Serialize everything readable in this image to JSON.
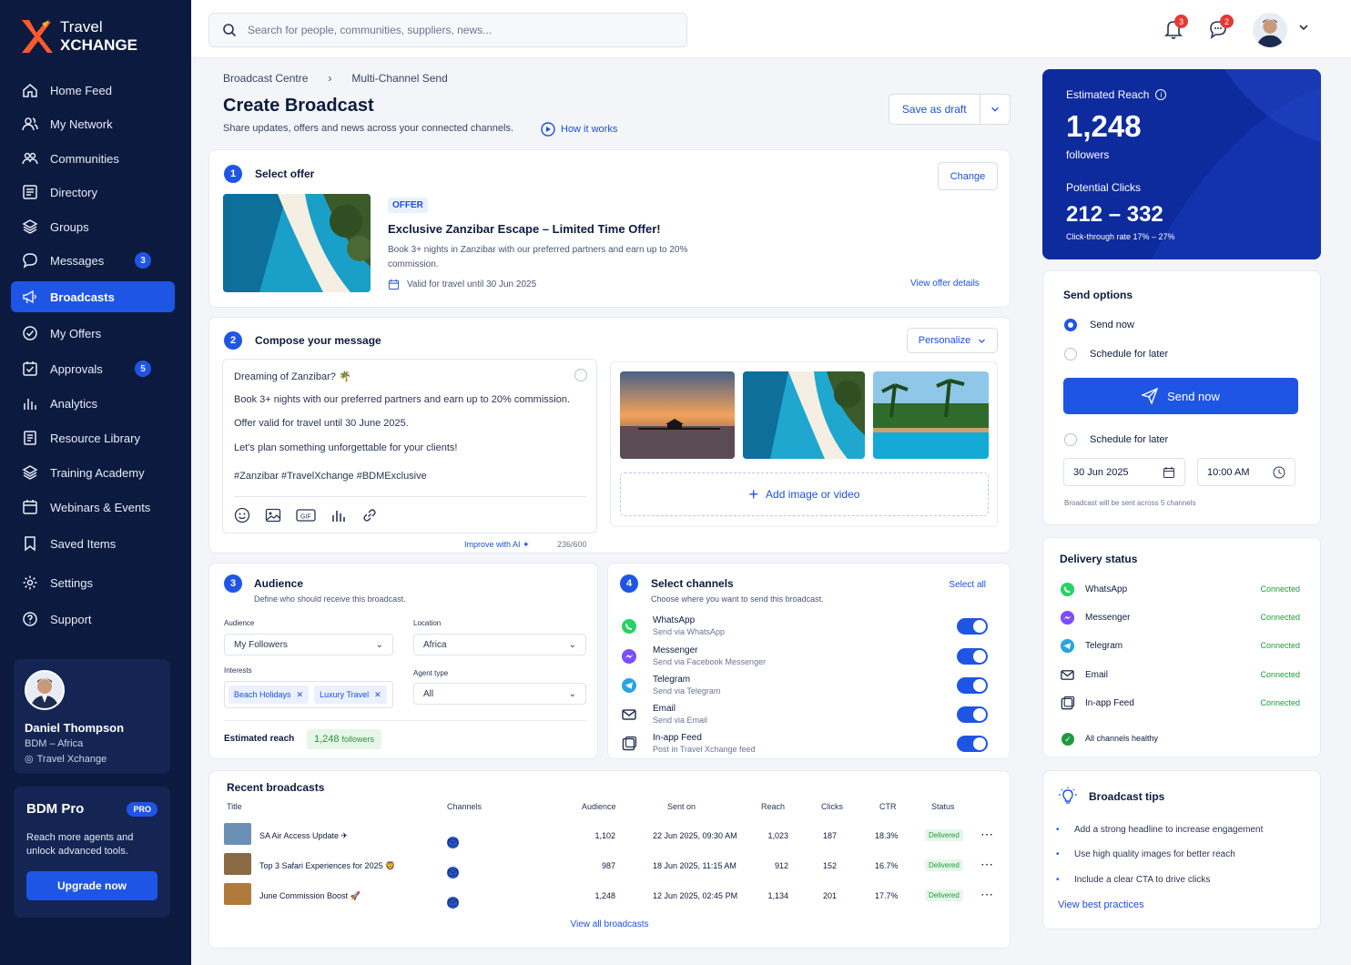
{
  "brand": {
    "line1": "Travel",
    "line2": "XCHANGE"
  },
  "nav": [
    {
      "label": "Home Feed",
      "icon": "home-icon"
    },
    {
      "label": "My Network",
      "icon": "users-icon"
    },
    {
      "label": "Communities",
      "icon": "community-icon"
    },
    {
      "label": "Directory",
      "icon": "directory-icon"
    },
    {
      "label": "Groups",
      "icon": "layers-icon"
    },
    {
      "label": "Messages",
      "icon": "chat-icon",
      "badge": "3"
    },
    {
      "label": "Broadcasts",
      "icon": "megaphone-icon",
      "active": true
    },
    {
      "label": "My Offers",
      "icon": "check-circle-icon"
    },
    {
      "label": "Approvals",
      "icon": "approval-icon",
      "badge": "5"
    },
    {
      "label": "Analytics",
      "icon": "bar-chart-icon"
    },
    {
      "label": "Resource Library",
      "icon": "library-icon"
    },
    {
      "label": "Training Academy",
      "icon": "academy-icon"
    },
    {
      "label": "Webinars & Events",
      "icon": "calendar-icon"
    },
    {
      "label": "Saved Items",
      "icon": "bookmark-icon"
    },
    {
      "label": "Settings",
      "icon": "gear-icon"
    },
    {
      "label": "Support",
      "icon": "support-icon"
    }
  ],
  "profile": {
    "name": "Daniel Thompson",
    "role": "BDM – Africa",
    "company": "Travel Xchange"
  },
  "pro": {
    "title": "BDM Pro",
    "badge": "PRO",
    "text1": "Reach more agents and",
    "text2": "unlock advanced tools.",
    "cta": "Upgrade now"
  },
  "search": {
    "placeholder": "Search for people, communities, suppliers, news..."
  },
  "topbar": {
    "notif_count": "3",
    "msg_count": "2"
  },
  "breadcrumb": {
    "root": "Broadcast Centre",
    "sep": "›",
    "current": "Multi-Channel Send"
  },
  "header": {
    "title": "Create Broadcast",
    "subtitle": "Share updates, offers and news across your connected channels.",
    "how": "How it works",
    "draft": "Save as draft"
  },
  "offer": {
    "step": "1",
    "title": "Select offer",
    "change": "Change",
    "tag": "OFFER",
    "name": "Exclusive Zanzibar Escape – Limited Time Offer!",
    "desc1": "Book 3+ nights in Zanzibar with our preferred partners and earn up to 20%",
    "desc2": "commission.",
    "valid": "Valid for travel until 30 Jun 2025",
    "details": "View offer details"
  },
  "compose": {
    "step": "2",
    "title": "Compose your message",
    "personalize": "Personalize",
    "l1": "Dreaming of Zanzibar? 🌴",
    "l2": "Book 3+ nights with our preferred partners and earn up to 20% commission.",
    "l3": "Offer valid for travel until 30 June 2025.",
    "l4": "Let's plan something unforgettable for your clients!",
    "l5": "#Zanzibar #TravelXchange #BDMExclusive",
    "ai": "Improve with AI",
    "count": "236/600",
    "add": "Add image or video"
  },
  "audience": {
    "step": "3",
    "title": "Audience",
    "sub": "Define who should receive this broadcast.",
    "aud_label": "Audience",
    "aud_val": "My Followers",
    "loc_label": "Location",
    "loc_val": "Africa",
    "int_label": "Interests",
    "chip1": "Beach Holidays",
    "chip2": "Luxury Travel",
    "agent_label": "Agent type",
    "agent_val": "All",
    "reach_label": "Estimated reach",
    "reach_val": "1,248",
    "reach_unit": "followers"
  },
  "channels": {
    "step": "4",
    "title": "Select channels",
    "sub": "Choose where you want to send this broadcast.",
    "select_all": "Select all",
    "items": [
      {
        "name": "WhatsApp",
        "desc": "Send via WhatsApp",
        "color": "#25d366"
      },
      {
        "name": "Messenger",
        "desc": "Send via Facebook Messenger",
        "color": "#7b4dff"
      },
      {
        "name": "Telegram",
        "desc": "Send via Telegram",
        "color": "#2aa3e0"
      },
      {
        "name": "Email",
        "desc": "Send via Email",
        "color": "#2a3553"
      },
      {
        "name": "In-app Feed",
        "desc": "Post in Travel Xchange feed",
        "color": "#2a3553"
      }
    ]
  },
  "recent": {
    "title": "Recent broadcasts",
    "headers": [
      "Title",
      "Channels",
      "Audience",
      "Sent on",
      "Reach",
      "Clicks",
      "CTR",
      "Status"
    ],
    "rows": [
      {
        "title": "SA Air Access Update ✈",
        "audience": "1,102",
        "sent": "22 Jun 2025, 09:30 AM",
        "reach": "1,023",
        "clicks": "187",
        "ctr": "18.3%",
        "status": "Delivered"
      },
      {
        "title": "Top 3 Safari Experiences for 2025 🦁",
        "audience": "987",
        "sent": "18 Jun 2025, 11:15 AM",
        "reach": "912",
        "clicks": "152",
        "ctr": "16.7%",
        "status": "Delivered"
      },
      {
        "title": "June Commission Boost 🚀",
        "audience": "1,248",
        "sent": "12 Jun 2025, 02:45 PM",
        "reach": "1,134",
        "clicks": "201",
        "ctr": "17.7%",
        "status": "Delivered"
      }
    ],
    "view_all": "View all broadcasts"
  },
  "reach": {
    "label": "Estimated Reach",
    "value": "1,248",
    "unit": "followers",
    "clicks_label": "Potential Clicks",
    "clicks": "212 – 332",
    "ctr": "Click-through rate 17% – 27%"
  },
  "send": {
    "title": "Send options",
    "opt1": "Send now",
    "opt2": "Schedule for later",
    "btn": "Send now",
    "opt3": "Schedule for later",
    "date": "30 Jun 2025",
    "time": "10:00 AM",
    "note": "Broadcast will be sent across 5 channels"
  },
  "delivery": {
    "title": "Delivery status",
    "items": [
      {
        "name": "WhatsApp",
        "status": "Connected",
        "color": "#25d366"
      },
      {
        "name": "Messenger",
        "status": "Connected",
        "color": "#7b4dff"
      },
      {
        "name": "Telegram",
        "status": "Connected",
        "color": "#2aa3e0"
      },
      {
        "name": "Email",
        "status": "Connected",
        "color": "#2a3553"
      },
      {
        "name": "In-app Feed",
        "status": "Connected",
        "color": "#2a3553"
      }
    ],
    "healthy": "All channels healthy"
  },
  "tips": {
    "title": "Broadcast tips",
    "t1": "Add a strong headline to increase engagement",
    "t2": "Use high quality images for better reach",
    "t3": "Include a clear CTA to drive clicks",
    "link": "View best practices"
  }
}
